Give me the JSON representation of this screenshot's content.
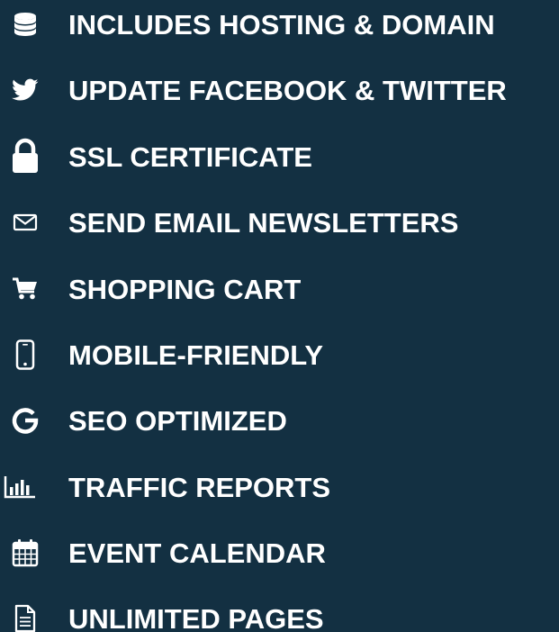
{
  "theme": {
    "background": "#133042",
    "text_color": "#ffffff"
  },
  "features": [
    {
      "icon": "database-icon",
      "label": "INCLUDES HOSTING & DOMAIN"
    },
    {
      "icon": "twitter-bird-icon",
      "label": "UPDATE FACEBOOK & TWITTER"
    },
    {
      "icon": "lock-icon",
      "label": "SSL CERTIFICATE"
    },
    {
      "icon": "envelope-icon",
      "label": "SEND EMAIL NEWSLETTERS"
    },
    {
      "icon": "shopping-cart-icon",
      "label": "SHOPPING CART"
    },
    {
      "icon": "mobile-phone-icon",
      "label": "MOBILE-FRIENDLY"
    },
    {
      "icon": "google-g-icon",
      "label": "SEO OPTIMIZED"
    },
    {
      "icon": "bar-chart-icon",
      "label": "TRAFFIC REPORTS"
    },
    {
      "icon": "calendar-icon",
      "label": "EVENT CALENDAR"
    },
    {
      "icon": "document-icon",
      "label": "UNLIMITED PAGES"
    }
  ]
}
